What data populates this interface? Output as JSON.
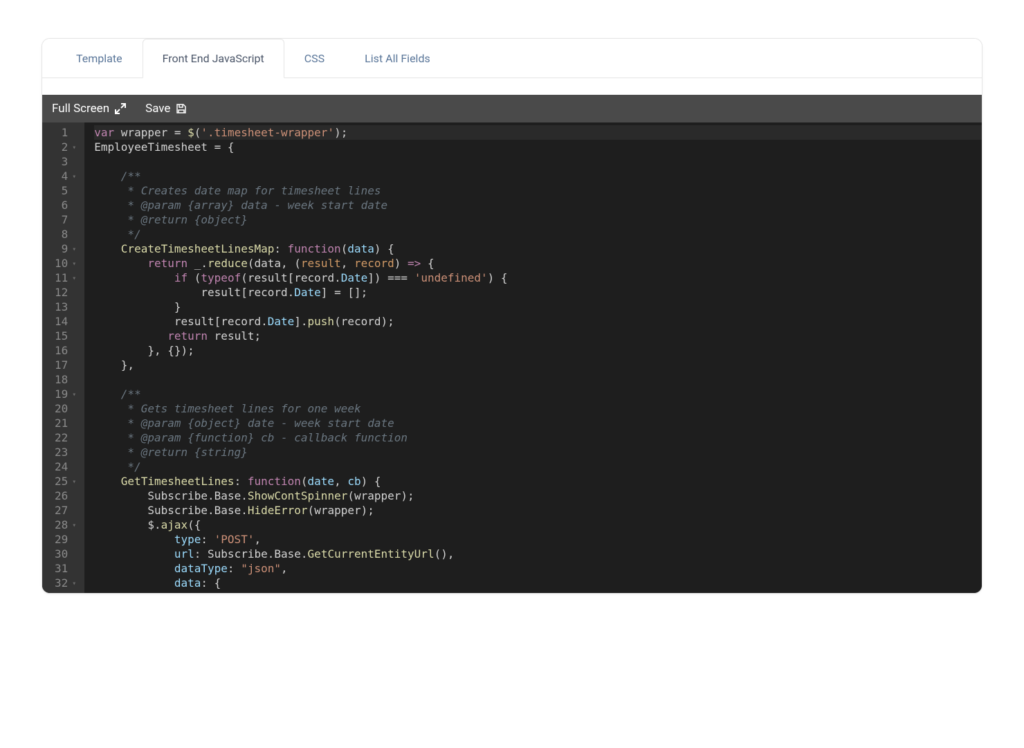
{
  "tabs": [
    {
      "label": "Template",
      "active": false
    },
    {
      "label": "Front End JavaScript",
      "active": true
    },
    {
      "label": "CSS",
      "active": false
    },
    {
      "label": "List All Fields",
      "active": false
    }
  ],
  "toolbar": {
    "fullscreen_label": "Full Screen",
    "save_label": "Save"
  },
  "gutter": {
    "start": 1,
    "end": 32,
    "fold_lines": [
      2,
      4,
      9,
      10,
      11,
      19,
      25,
      28,
      32
    ]
  },
  "code": {
    "lines": [
      {
        "n": 1,
        "hl": true,
        "tokens": [
          {
            "t": "var ",
            "c": "tok-kw"
          },
          {
            "t": "wrapper ",
            "c": "tok-var"
          },
          {
            "t": "= ",
            "c": "tok-op"
          },
          {
            "t": "$",
            "c": "tok-fn"
          },
          {
            "t": "(",
            "c": "tok-punct"
          },
          {
            "t": "'.timesheet-wrapper'",
            "c": "tok-str2"
          },
          {
            "t": ");",
            "c": "tok-punct"
          }
        ]
      },
      {
        "n": 2,
        "tokens": [
          {
            "t": "EmployeeTimesheet ",
            "c": "tok-var"
          },
          {
            "t": "= {",
            "c": "tok-op"
          }
        ]
      },
      {
        "n": 3,
        "tokens": [
          {
            "t": "",
            "c": ""
          }
        ]
      },
      {
        "n": 4,
        "tokens": [
          {
            "t": "    /**",
            "c": "tok-comment"
          }
        ]
      },
      {
        "n": 5,
        "tokens": [
          {
            "t": "     * Creates date map for timesheet lines",
            "c": "tok-comment"
          }
        ]
      },
      {
        "n": 6,
        "tokens": [
          {
            "t": "     * @param {array} data - week start date",
            "c": "tok-comment"
          }
        ]
      },
      {
        "n": 7,
        "tokens": [
          {
            "t": "     * @return {object}",
            "c": "tok-comment"
          }
        ]
      },
      {
        "n": 8,
        "tokens": [
          {
            "t": "     */",
            "c": "tok-comment"
          }
        ]
      },
      {
        "n": 9,
        "tokens": [
          {
            "t": "    ",
            "c": ""
          },
          {
            "t": "CreateTimesheetLinesMap",
            "c": "tok-fn"
          },
          {
            "t": ": ",
            "c": "tok-punct"
          },
          {
            "t": "function",
            "c": "tok-kw"
          },
          {
            "t": "(",
            "c": "tok-punct"
          },
          {
            "t": "data",
            "c": "tok-paramlight"
          },
          {
            "t": ") {",
            "c": "tok-punct"
          }
        ]
      },
      {
        "n": 10,
        "tokens": [
          {
            "t": "        ",
            "c": ""
          },
          {
            "t": "return ",
            "c": "tok-kw"
          },
          {
            "t": "_",
            "c": "tok-var"
          },
          {
            "t": ".",
            "c": "tok-punct"
          },
          {
            "t": "reduce",
            "c": "tok-fn"
          },
          {
            "t": "(",
            "c": "tok-punct"
          },
          {
            "t": "data",
            "c": "tok-var"
          },
          {
            "t": ", (",
            "c": "tok-punct"
          },
          {
            "t": "result",
            "c": "tok-param"
          },
          {
            "t": ", ",
            "c": "tok-punct"
          },
          {
            "t": "record",
            "c": "tok-param"
          },
          {
            "t": ") ",
            "c": "tok-punct"
          },
          {
            "t": "=> ",
            "c": "tok-kw"
          },
          {
            "t": "{",
            "c": "tok-punct"
          }
        ]
      },
      {
        "n": 11,
        "tokens": [
          {
            "t": "            ",
            "c": ""
          },
          {
            "t": "if ",
            "c": "tok-kw"
          },
          {
            "t": "(",
            "c": "tok-punct"
          },
          {
            "t": "typeof",
            "c": "tok-kw"
          },
          {
            "t": "(",
            "c": "tok-punct"
          },
          {
            "t": "result",
            "c": "tok-var"
          },
          {
            "t": "[",
            "c": "tok-punct"
          },
          {
            "t": "record",
            "c": "tok-var"
          },
          {
            "t": ".",
            "c": "tok-punct"
          },
          {
            "t": "Date",
            "c": "tok-prop"
          },
          {
            "t": "]) ",
            "c": "tok-punct"
          },
          {
            "t": "=== ",
            "c": "tok-op"
          },
          {
            "t": "'undefined'",
            "c": "tok-str2"
          },
          {
            "t": ") {",
            "c": "tok-punct"
          }
        ]
      },
      {
        "n": 12,
        "tokens": [
          {
            "t": "                ",
            "c": ""
          },
          {
            "t": "result",
            "c": "tok-var"
          },
          {
            "t": "[",
            "c": "tok-punct"
          },
          {
            "t": "record",
            "c": "tok-var"
          },
          {
            "t": ".",
            "c": "tok-punct"
          },
          {
            "t": "Date",
            "c": "tok-prop"
          },
          {
            "t": "] = [];",
            "c": "tok-punct"
          }
        ]
      },
      {
        "n": 13,
        "tokens": [
          {
            "t": "            }",
            "c": "tok-punct"
          }
        ]
      },
      {
        "n": 14,
        "tokens": [
          {
            "t": "            ",
            "c": ""
          },
          {
            "t": "result",
            "c": "tok-var"
          },
          {
            "t": "[",
            "c": "tok-punct"
          },
          {
            "t": "record",
            "c": "tok-var"
          },
          {
            "t": ".",
            "c": "tok-punct"
          },
          {
            "t": "Date",
            "c": "tok-prop"
          },
          {
            "t": "].",
            "c": "tok-punct"
          },
          {
            "t": "push",
            "c": "tok-fn"
          },
          {
            "t": "(",
            "c": "tok-punct"
          },
          {
            "t": "record",
            "c": "tok-var"
          },
          {
            "t": ");",
            "c": "tok-punct"
          }
        ]
      },
      {
        "n": 15,
        "tokens": [
          {
            "t": "           ",
            "c": ""
          },
          {
            "t": "return ",
            "c": "tok-kw"
          },
          {
            "t": "result",
            "c": "tok-var"
          },
          {
            "t": ";",
            "c": "tok-punct"
          }
        ]
      },
      {
        "n": 16,
        "tokens": [
          {
            "t": "        }, {});",
            "c": "tok-punct"
          }
        ]
      },
      {
        "n": 17,
        "tokens": [
          {
            "t": "    },",
            "c": "tok-punct"
          }
        ]
      },
      {
        "n": 18,
        "tokens": [
          {
            "t": "",
            "c": ""
          }
        ]
      },
      {
        "n": 19,
        "tokens": [
          {
            "t": "    /**",
            "c": "tok-comment"
          }
        ]
      },
      {
        "n": 20,
        "tokens": [
          {
            "t": "     * Gets timesheet lines for one week",
            "c": "tok-comment"
          }
        ]
      },
      {
        "n": 21,
        "tokens": [
          {
            "t": "     * @param {object} date - week start date",
            "c": "tok-comment"
          }
        ]
      },
      {
        "n": 22,
        "tokens": [
          {
            "t": "     * @param {function} cb - callback function",
            "c": "tok-comment"
          }
        ]
      },
      {
        "n": 23,
        "tokens": [
          {
            "t": "     * @return {string}",
            "c": "tok-comment"
          }
        ]
      },
      {
        "n": 24,
        "tokens": [
          {
            "t": "     */",
            "c": "tok-comment"
          }
        ]
      },
      {
        "n": 25,
        "tokens": [
          {
            "t": "    ",
            "c": ""
          },
          {
            "t": "GetTimesheetLines",
            "c": "tok-fn"
          },
          {
            "t": ": ",
            "c": "tok-punct"
          },
          {
            "t": "function",
            "c": "tok-kw"
          },
          {
            "t": "(",
            "c": "tok-punct"
          },
          {
            "t": "date",
            "c": "tok-paramlight"
          },
          {
            "t": ", ",
            "c": "tok-punct"
          },
          {
            "t": "cb",
            "c": "tok-paramlight"
          },
          {
            "t": ") {",
            "c": "tok-punct"
          }
        ]
      },
      {
        "n": 26,
        "tokens": [
          {
            "t": "        ",
            "c": ""
          },
          {
            "t": "Subscribe",
            "c": "tok-var"
          },
          {
            "t": ".",
            "c": "tok-punct"
          },
          {
            "t": "Base",
            "c": "tok-var"
          },
          {
            "t": ".",
            "c": "tok-punct"
          },
          {
            "t": "ShowContSpinner",
            "c": "tok-fn"
          },
          {
            "t": "(",
            "c": "tok-punct"
          },
          {
            "t": "wrapper",
            "c": "tok-var"
          },
          {
            "t": ");",
            "c": "tok-punct"
          }
        ]
      },
      {
        "n": 27,
        "tokens": [
          {
            "t": "        ",
            "c": ""
          },
          {
            "t": "Subscribe",
            "c": "tok-var"
          },
          {
            "t": ".",
            "c": "tok-punct"
          },
          {
            "t": "Base",
            "c": "tok-var"
          },
          {
            "t": ".",
            "c": "tok-punct"
          },
          {
            "t": "HideError",
            "c": "tok-fn"
          },
          {
            "t": "(",
            "c": "tok-punct"
          },
          {
            "t": "wrapper",
            "c": "tok-var"
          },
          {
            "t": ");",
            "c": "tok-punct"
          }
        ]
      },
      {
        "n": 28,
        "tokens": [
          {
            "t": "        ",
            "c": ""
          },
          {
            "t": "$",
            "c": "tok-var"
          },
          {
            "t": ".",
            "c": "tok-punct"
          },
          {
            "t": "ajax",
            "c": "tok-fn"
          },
          {
            "t": "({",
            "c": "tok-punct"
          }
        ]
      },
      {
        "n": 29,
        "tokens": [
          {
            "t": "            ",
            "c": ""
          },
          {
            "t": "type",
            "c": "tok-prop"
          },
          {
            "t": ": ",
            "c": "tok-punct"
          },
          {
            "t": "'POST'",
            "c": "tok-str2"
          },
          {
            "t": ",",
            "c": "tok-punct"
          }
        ]
      },
      {
        "n": 30,
        "tokens": [
          {
            "t": "            ",
            "c": ""
          },
          {
            "t": "url",
            "c": "tok-prop"
          },
          {
            "t": ": ",
            "c": "tok-punct"
          },
          {
            "t": "Subscribe",
            "c": "tok-var"
          },
          {
            "t": ".",
            "c": "tok-punct"
          },
          {
            "t": "Base",
            "c": "tok-var"
          },
          {
            "t": ".",
            "c": "tok-punct"
          },
          {
            "t": "GetCurrentEntityUrl",
            "c": "tok-fn"
          },
          {
            "t": "(),",
            "c": "tok-punct"
          }
        ]
      },
      {
        "n": 31,
        "tokens": [
          {
            "t": "            ",
            "c": ""
          },
          {
            "t": "dataType",
            "c": "tok-prop"
          },
          {
            "t": ": ",
            "c": "tok-punct"
          },
          {
            "t": "\"json\"",
            "c": "tok-str2"
          },
          {
            "t": ",",
            "c": "tok-punct"
          }
        ]
      },
      {
        "n": 32,
        "tokens": [
          {
            "t": "            ",
            "c": ""
          },
          {
            "t": "data",
            "c": "tok-prop"
          },
          {
            "t": ": {",
            "c": "tok-punct"
          }
        ]
      }
    ]
  }
}
